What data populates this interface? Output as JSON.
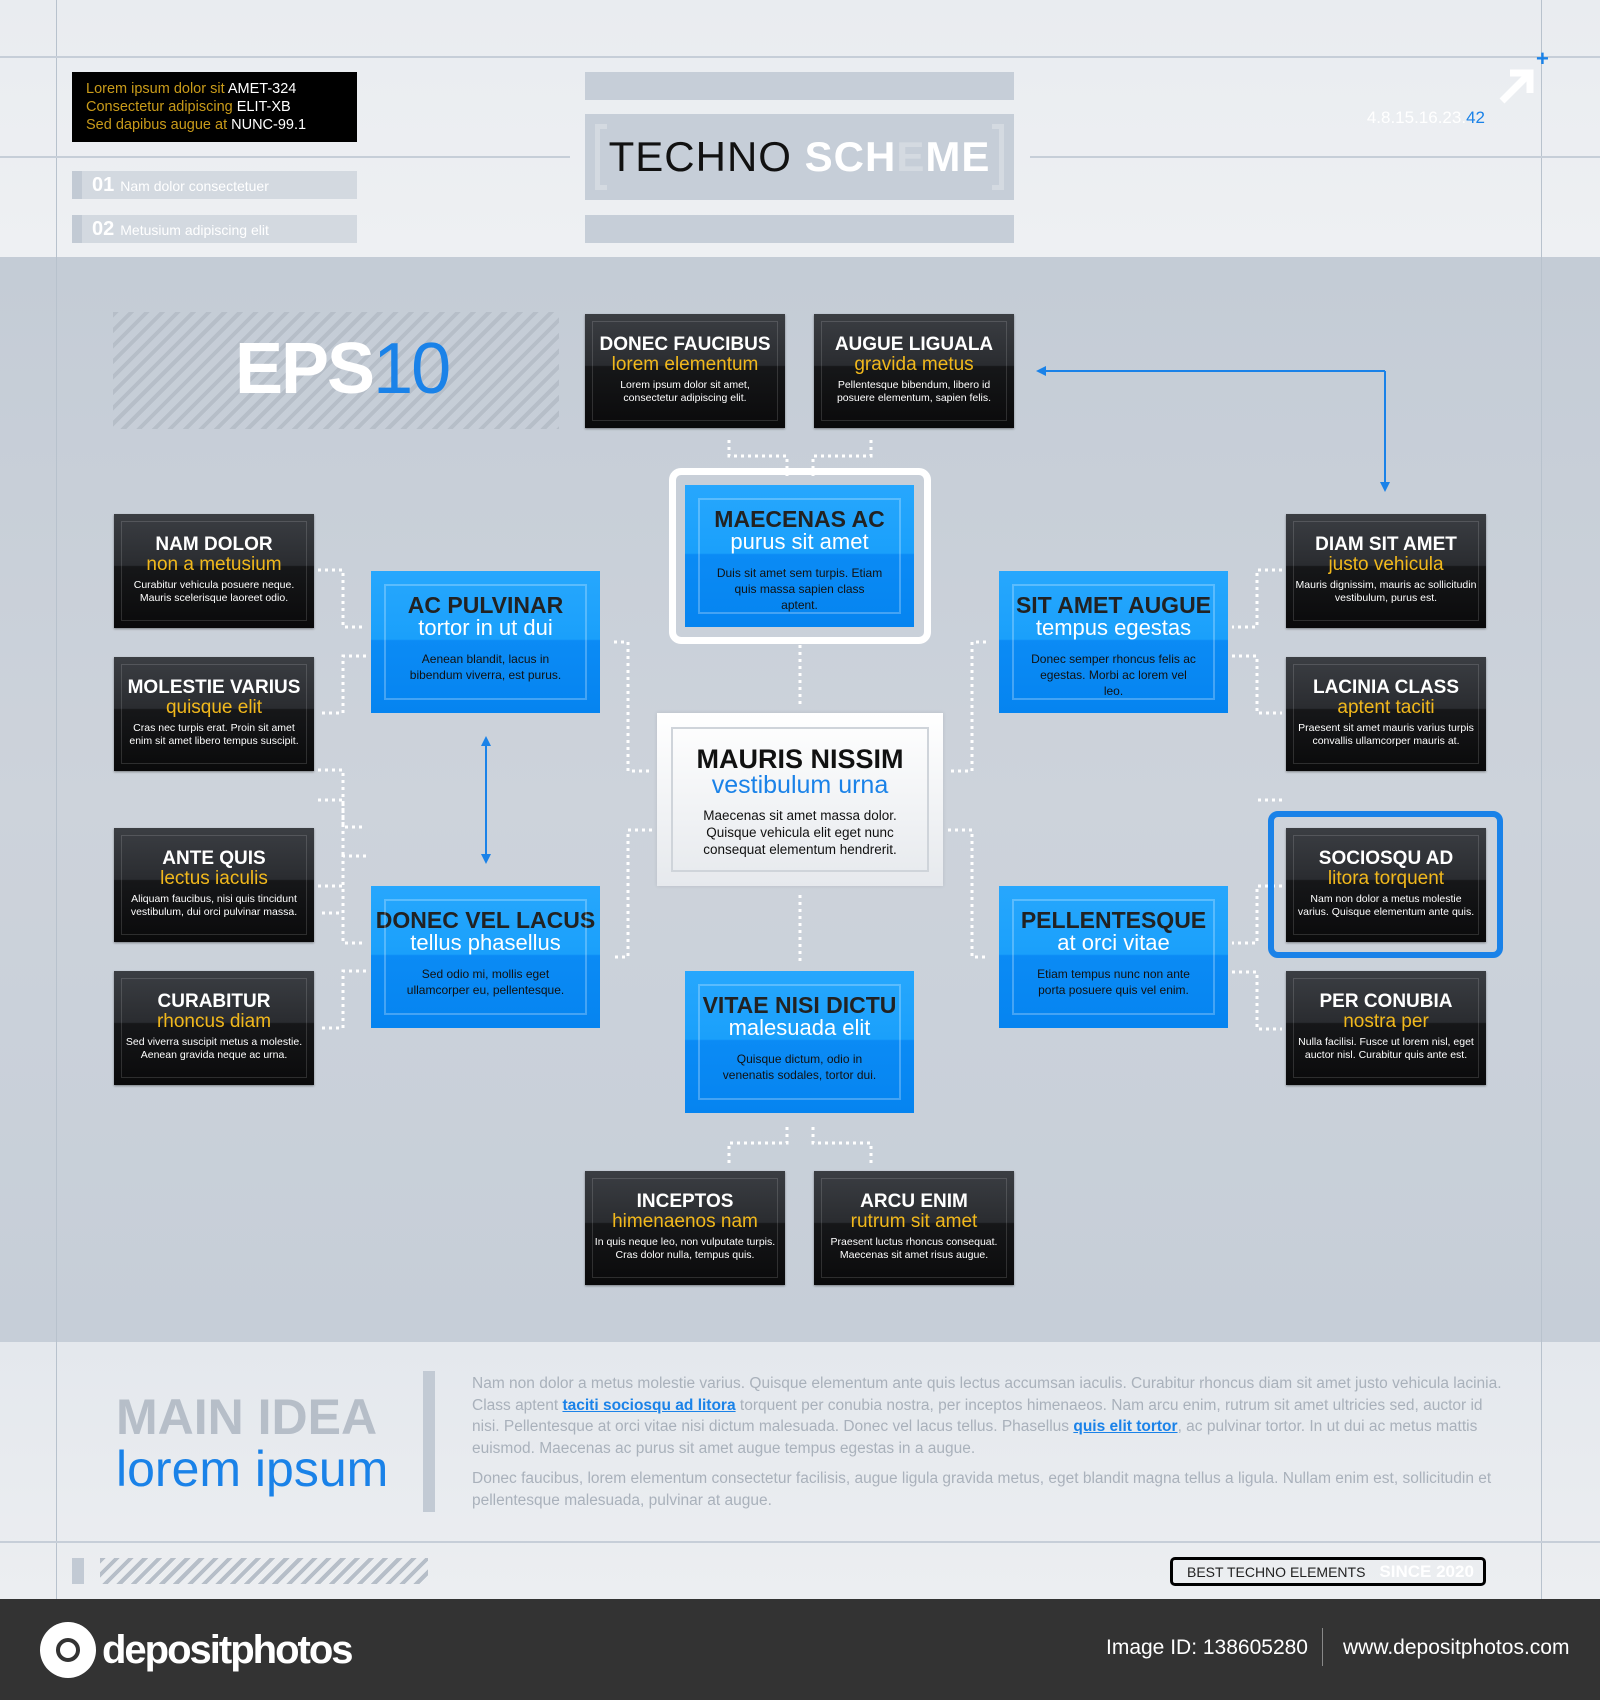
{
  "header": {
    "info_lines": [
      {
        "label": "Lorem ipsum dolor sit",
        "code": "AMET-324"
      },
      {
        "label": "Consectetur adipiscing",
        "code": "ELIT-XB"
      },
      {
        "label": "Sed dapibus augue at",
        "code": "NUNC-99.1"
      }
    ],
    "items": [
      {
        "num": "01",
        "label": "Nam dolor consectetuer"
      },
      {
        "num": "02",
        "label": "Metusium adipiscing elit"
      }
    ],
    "title_dark": "TECHNO",
    "title_light_1": "SCH",
    "title_light_2": "E",
    "title_light_3": "ME",
    "version": "4.8.15.16.23.",
    "version_accent": "42",
    "arrow_icon": "arrow-up-right"
  },
  "eps": {
    "text": "EPS",
    "accent": "10"
  },
  "boxes": [
    {
      "type": "dark",
      "title": "DONEC FAUCIBUS",
      "subtitle": "lorem elementum",
      "body": "Lorem ipsum dolor sit amet, consectetur adipiscing elit."
    },
    {
      "type": "dark",
      "title": "AUGUE LIGUALA",
      "subtitle": "gravida metus",
      "body": "Pellentesque bibendum, libero id posuere elementum, sapien felis."
    },
    {
      "type": "dark",
      "title": "NAM DOLOR",
      "subtitle": "non a metusium",
      "body": "Curabitur vehicula posuere neque. Mauris scelerisque laoreet odio."
    },
    {
      "type": "dark",
      "title": "MOLESTIE VARIUS",
      "subtitle": "quisque elit",
      "body": "Cras nec turpis erat. Proin sit amet enim sit amet libero tempus suscipit."
    },
    {
      "type": "dark",
      "title": "ANTE QUIS",
      "subtitle": "lectus iaculis",
      "body": "Aliquam faucibus, nisi quis tincidunt vestibulum, dui orci pulvinar massa."
    },
    {
      "type": "dark",
      "title": "CURABITUR",
      "subtitle": "rhoncus diam",
      "body": "Sed viverra suscipit metus a molestie. Aenean gravida neque ac urna."
    },
    {
      "type": "dark",
      "title": "DIAM SIT AMET",
      "subtitle": "justo vehicula",
      "body": "Mauris dignissim, mauris ac sollicitudin vestibulum, purus est."
    },
    {
      "type": "dark",
      "title": "LACINIA CLASS",
      "subtitle": "aptent taciti",
      "body": "Praesent sit amet mauris varius turpis convallis ullamcorper mauris at."
    },
    {
      "type": "dark",
      "title": "SOCIOSQU AD",
      "subtitle": "litora torquent",
      "body": "Nam non dolor a metus molestie varius. Quisque elementum ante quis."
    },
    {
      "type": "dark",
      "title": "PER CONUBIA",
      "subtitle": "nostra per",
      "body": "Nulla facilisi. Fusce ut lorem nisl, eget auctor nisl. Curabitur quis ante est."
    },
    {
      "type": "dark",
      "title": "INCEPTOS",
      "subtitle": "himenaenos nam",
      "body": "In quis neque leo, non vulputate turpis. Cras dolor nulla, tempus quis."
    },
    {
      "type": "dark",
      "title": "ARCU ENIM",
      "subtitle": "rutrum sit amet",
      "body": "Praesent luctus rhoncus consequat. Maecenas sit amet risus augue."
    },
    {
      "type": "blue",
      "title": "MAECENAS AC",
      "subtitle": "purus sit amet",
      "body": "Duis sit amet sem turpis. Etiam quis massa sapien class aptent."
    },
    {
      "type": "blue",
      "title": "AC PULVINAR",
      "subtitle": "tortor in ut dui",
      "body": "Aenean blandit, lacus in bibendum viverra, est purus."
    },
    {
      "type": "blue",
      "title": "SIT AMET AUGUE",
      "subtitle": "tempus egestas",
      "body": "Donec semper rhoncus felis ac egestas. Morbi ac lorem vel leo."
    },
    {
      "type": "blue",
      "title": "DONEC VEL LACUS",
      "subtitle": "tellus phasellus",
      "body": "Sed odio mi, mollis eget ullamcorper eu, pellentesque."
    },
    {
      "type": "blue",
      "title": "PELLENTESQUE",
      "subtitle": "at orci vitae",
      "body": "Etiam tempus nunc non ante porta posuere quis vel enim."
    },
    {
      "type": "blue",
      "title": "VITAE NISI DICTU",
      "subtitle": "malesuada elit",
      "body": "Quisque dictum, odio in venenatis sodales, tortor dui."
    },
    {
      "type": "white",
      "title": "MAURIS NISSIM",
      "subtitle": "vestibulum urna",
      "body": "Maecenas sit amet massa dolor. Quisque vehicula elit eget nunc consequat elementum hendrerit."
    }
  ],
  "main_idea": {
    "title": "MAIN IDEA",
    "subtitle": "lorem ipsum",
    "p1_a": "Nam non dolor a metus molestie varius. Quisque elementum ante quis lectus accumsan iaculis. Curabitur rhoncus diam sit amet justo vehicula lacinia. Class aptent ",
    "p1_link1": "taciti sociosqu ad litora",
    "p1_b": " torquent per conubia nostra, per inceptos himenaeos. Nam arcu enim, rutrum sit amet ultricies sed, auctor id nisi. Pellentesque at orci vitae nisi dictum malesuada. Donec vel lacus tellus. Phasellus ",
    "p1_link2": "quis elit tortor",
    "p1_c": ", ac pulvinar tortor. In ut dui ac metus mattis euismod. Maecenas ac purus sit amet augue tempus egestas in a augue.",
    "p2": "Donec faucibus, lorem elementum consectetur facilisis, augue ligula gravida metus, eget blandit magna tellus a ligula. Nullam enim est, sollicitudin et pellentesque malesuada, pulvinar at augue."
  },
  "badge": {
    "label": "BEST TECHNO ELEMENTS",
    "accent": "SINCE 2020"
  },
  "footer": {
    "logo": "depositphotos",
    "image_id": "Image ID: 138605280",
    "site": "www.depositphotos.com"
  },
  "colors": {
    "accent": "#1a82e8",
    "yellow": "#f1b81c",
    "dark": "#111111",
    "bg": "#c9d0d9"
  }
}
